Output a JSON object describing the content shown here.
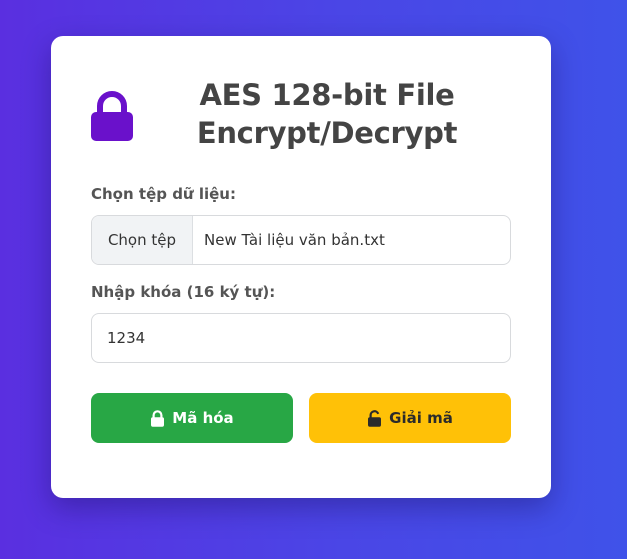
{
  "app": {
    "title": "AES 128-bit File Encrypt/Decrypt",
    "title_icon": "lock-icon",
    "title_icon_color": "#6a11cb"
  },
  "form": {
    "file_label": "Chọn tệp dữ liệu:",
    "file_button_label": "Chọn tệp",
    "file_name": "New Tài liệu văn bản.txt",
    "key_label": "Nhập khóa (16 ký tự):",
    "key_value": "1234"
  },
  "actions": {
    "encrypt_label": "Mã hóa",
    "encrypt_icon": "lock-icon",
    "encrypt_color": "#28a745",
    "decrypt_label": "Giải mã",
    "decrypt_icon": "unlock-icon",
    "decrypt_color": "#ffc107"
  }
}
